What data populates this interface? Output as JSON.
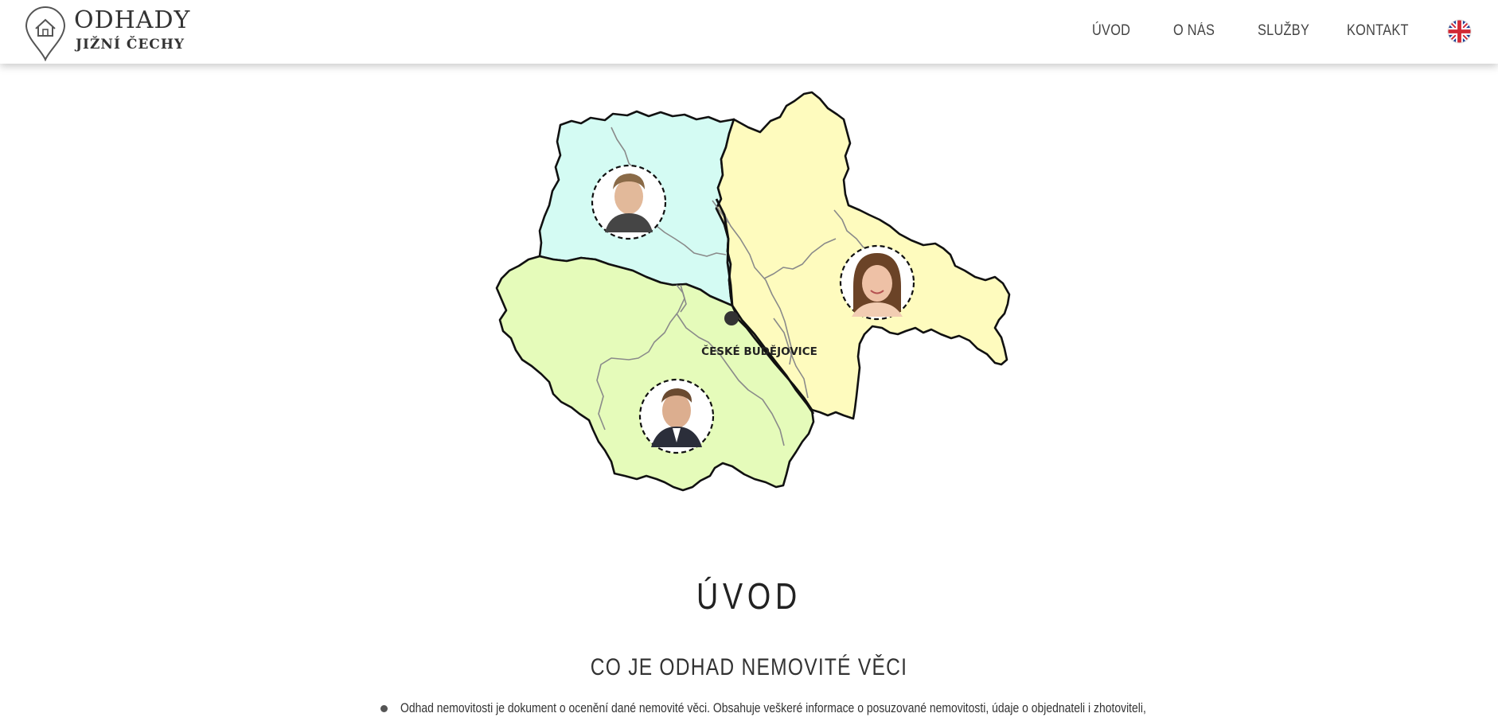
{
  "header": {
    "logo": {
      "line1": "ODHADY",
      "line2": "JIŽNÍ ČECHY"
    },
    "nav": [
      {
        "label": "ÚVOD"
      },
      {
        "label": "O NÁS"
      },
      {
        "label": "SLUŽBY"
      },
      {
        "label": "KONTAKT"
      }
    ],
    "language_flag": "uk-flag-icon"
  },
  "map": {
    "city_label": "ČESKÉ BUDĚJOVICE",
    "region_colors": {
      "north_west": "#d4fbf3",
      "east": "#fefbbe",
      "south_west": "#e5fbba"
    },
    "appraisers": [
      {
        "region": "north_west",
        "icon": "person-avatar-icon"
      },
      {
        "region": "east",
        "icon": "person-avatar-icon"
      },
      {
        "region": "south_west",
        "icon": "person-avatar-icon"
      }
    ]
  },
  "main": {
    "section_title": "ÚVOD",
    "sub_title": "CO JE ODHAD NEMOVITÉ VĚCI",
    "bullets": [
      "Odhad nemovitosti je dokument o ocenění dané nemovité věci. Obsahuje veškeré informace o posuzované nemovitosti, údaje o objednateli i zhotoviteli,"
    ]
  }
}
